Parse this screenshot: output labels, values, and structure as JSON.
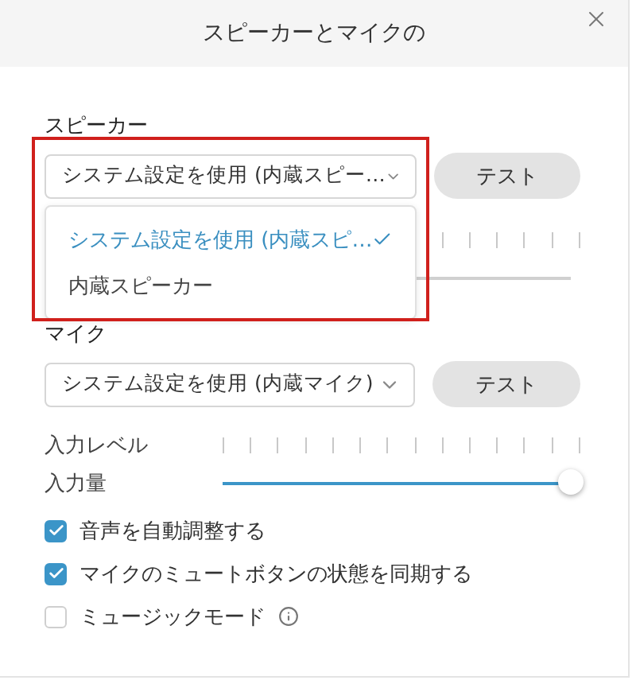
{
  "window": {
    "title": "スピーカーとマイクの"
  },
  "speaker": {
    "label": "スピーカー",
    "device": "システム設定を使用 (内蔵スピー…",
    "test_button": "テスト",
    "dropdown": {
      "options": [
        {
          "label": "システム設定を使用 (内蔵スピ…",
          "selected": true
        },
        {
          "label": "内蔵スピーカー",
          "selected": false
        }
      ]
    }
  },
  "microphone": {
    "label": "マイク",
    "device": "システム設定を使用 (内蔵マイク)",
    "test_button": "テスト",
    "input_level_label": "入力レベル",
    "input_volume_label": "入力量",
    "input_volume": {
      "level": 1
    }
  },
  "options": [
    {
      "label": "音声を自動調整する",
      "checked": true,
      "info": false
    },
    {
      "label": "マイクのミュートボタンの状態を同期する",
      "checked": true,
      "info": false
    },
    {
      "label": "ミュージックモード",
      "checked": false,
      "info": true
    }
  ]
}
